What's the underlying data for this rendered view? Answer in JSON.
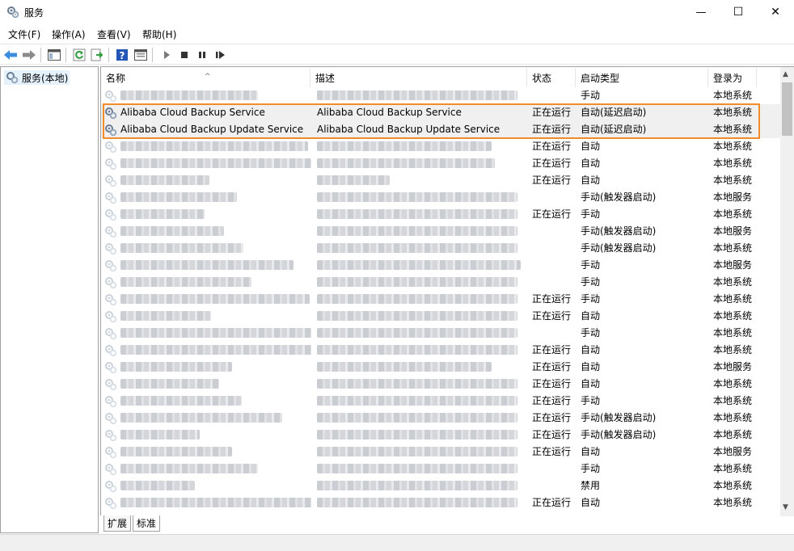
{
  "window": {
    "title": "服务",
    "minimize": "—",
    "maximize": "☐",
    "close": "✕"
  },
  "menu": [
    "文件(F)",
    "操作(A)",
    "查看(V)",
    "帮助(H)"
  ],
  "tree": {
    "root": "服务(本地)"
  },
  "columns": {
    "name": "名称",
    "desc": "描述",
    "status": "状态",
    "startup": "启动类型",
    "logon": "登录为"
  },
  "rows": [
    {
      "name": "",
      "desc": "",
      "status": "",
      "startup": "手动",
      "logon": "本地系统",
      "blurred": true
    },
    {
      "name": "Alibaba Cloud Backup Service",
      "desc": "Alibaba Cloud Backup Service",
      "status": "正在运行",
      "startup": "自动(延迟启动)",
      "logon": "本地系统",
      "blurred": false
    },
    {
      "name": "Alibaba Cloud Backup Update Service",
      "desc": "Alibaba Cloud Backup Update Service",
      "status": "正在运行",
      "startup": "自动(延迟启动)",
      "logon": "本地系统",
      "blurred": false
    },
    {
      "name": "",
      "desc": "",
      "status": "正在运行",
      "startup": "自动",
      "logon": "本地系统",
      "blurred": true
    },
    {
      "name": "",
      "desc": "",
      "status": "正在运行",
      "startup": "自动",
      "logon": "本地系统",
      "blurred": true
    },
    {
      "name": "",
      "desc": "",
      "status": "正在运行",
      "startup": "自动",
      "logon": "本地系统",
      "blurred": true
    },
    {
      "name": "",
      "desc": "",
      "status": "",
      "startup": "手动(触发器启动)",
      "logon": "本地服务",
      "blurred": true
    },
    {
      "name": "",
      "desc": "",
      "status": "正在运行",
      "startup": "手动",
      "logon": "本地系统",
      "blurred": true
    },
    {
      "name": "",
      "desc": "",
      "status": "",
      "startup": "手动(触发器启动)",
      "logon": "本地服务",
      "blurred": true
    },
    {
      "name": "",
      "desc": "",
      "status": "",
      "startup": "手动(触发器启动)",
      "logon": "本地系统",
      "blurred": true
    },
    {
      "name": "",
      "desc": "",
      "status": "",
      "startup": "手动",
      "logon": "本地服务",
      "blurred": true
    },
    {
      "name": "",
      "desc": "",
      "status": "",
      "startup": "手动",
      "logon": "本地系统",
      "blurred": true
    },
    {
      "name": "",
      "desc": "",
      "status": "正在运行",
      "startup": "手动",
      "logon": "本地系统",
      "blurred": true
    },
    {
      "name": "",
      "desc": "",
      "status": "正在运行",
      "startup": "自动",
      "logon": "本地系统",
      "blurred": true
    },
    {
      "name": "",
      "desc": "",
      "status": "",
      "startup": "手动",
      "logon": "本地系统",
      "blurred": true
    },
    {
      "name": "",
      "desc": "",
      "status": "正在运行",
      "startup": "自动",
      "logon": "本地系统",
      "blurred": true
    },
    {
      "name": "",
      "desc": "",
      "status": "正在运行",
      "startup": "自动",
      "logon": "本地服务",
      "blurred": true
    },
    {
      "name": "",
      "desc": "",
      "status": "正在运行",
      "startup": "自动",
      "logon": "本地系统",
      "blurred": true
    },
    {
      "name": "",
      "desc": "",
      "status": "正在运行",
      "startup": "手动",
      "logon": "本地系统",
      "blurred": true
    },
    {
      "name": "",
      "desc": "",
      "status": "正在运行",
      "startup": "手动(触发器启动)",
      "logon": "本地系统",
      "blurred": true
    },
    {
      "name": "",
      "desc": "",
      "status": "正在运行",
      "startup": "手动(触发器启动)",
      "logon": "本地系统",
      "blurred": true
    },
    {
      "name": "",
      "desc": "",
      "status": "正在运行",
      "startup": "自动",
      "logon": "本地服务",
      "blurred": true
    },
    {
      "name": "",
      "desc": "",
      "status": "",
      "startup": "手动",
      "logon": "本地系统",
      "blurred": true
    },
    {
      "name": "",
      "desc": "",
      "status": "",
      "startup": "禁用",
      "logon": "本地系统",
      "blurred": true
    },
    {
      "name": "",
      "desc": "",
      "status": "正在运行",
      "startup": "自动",
      "logon": "本地系统",
      "blurred": true
    }
  ],
  "tabs": [
    "扩展",
    "标准"
  ],
  "colors": {
    "highlight_border": "#f28c28",
    "selected_tree_bg": "#e5f1fb"
  },
  "icons": [
    "gear-icon",
    "back-arrow-icon",
    "forward-arrow-icon",
    "console-tree-icon",
    "refresh-icon",
    "export-list-icon",
    "help-icon",
    "properties-icon",
    "play-icon",
    "stop-icon",
    "pause-icon",
    "restart-icon"
  ]
}
